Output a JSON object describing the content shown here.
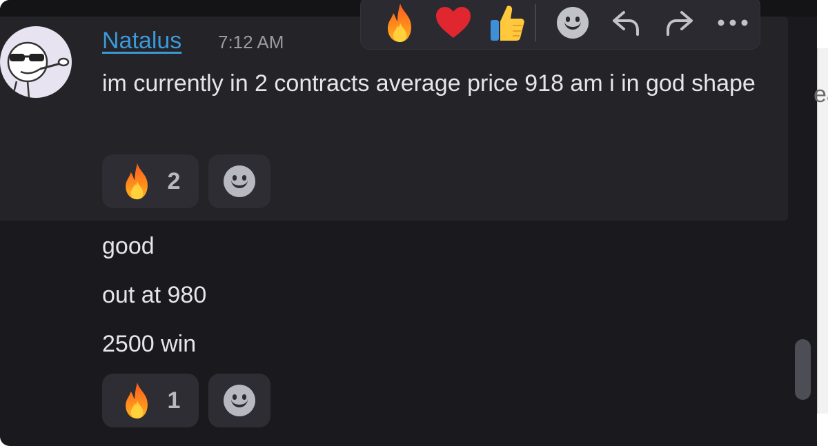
{
  "message_group": {
    "author": "Natalus",
    "timestamp": "7:12 AM",
    "message_1": {
      "text": "im currently in 2 contracts average price 918 am i in god shape",
      "reactions": [
        {
          "emoji": "fire-icon",
          "count": "2"
        }
      ]
    },
    "follow_up_messages": [
      "good",
      "out at 980",
      "2500 win"
    ],
    "follow_up_reactions": [
      {
        "emoji": "fire-icon",
        "count": "1"
      }
    ]
  },
  "hover_toolbar": {
    "quick_reactions": [
      "fire-icon",
      "heart-icon",
      "thumbs-up-icon"
    ],
    "actions": [
      "add-reaction-icon",
      "reply-icon",
      "forward-icon",
      "more-icon"
    ]
  },
  "right_panel": {
    "partial_text": "ea"
  },
  "colors": {
    "background": "#1a1a1e",
    "hover_background": "#232328",
    "author": "#3c99d8",
    "text": "#e6e6ea"
  }
}
